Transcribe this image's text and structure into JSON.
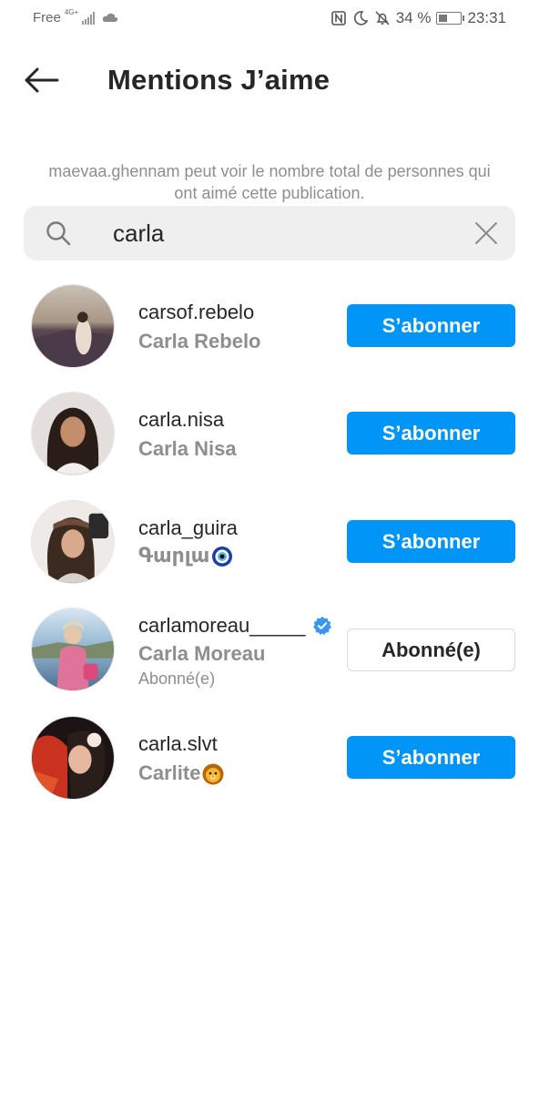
{
  "status_bar": {
    "carrier": "Free",
    "network": "4G+",
    "battery": "34 %",
    "time": "23:31"
  },
  "header": {
    "title": "Mentions J’aime",
    "back_icon": "arrow-left-icon"
  },
  "info_text": "maevaa.ghennam peut voir le nombre total de personnes qui ont aimé cette publication.",
  "search": {
    "value": "carla"
  },
  "users": [
    {
      "username": "carsof.rebelo",
      "fullname": "Carla Rebelo",
      "button": "S’abonner",
      "following": false
    },
    {
      "username": "carla.nisa",
      "fullname": "Carla Nisa",
      "button": "S’abonner",
      "following": false
    },
    {
      "username": "carla_guira",
      "fullname": "Գարլա",
      "button": "S’abonner",
      "following": false,
      "emoji": "nazar-amulet-icon"
    },
    {
      "username": "carlamoreau_____",
      "fullname": "Carla Moreau",
      "subtext": "Abonné(e)",
      "button": "Abonné(e)",
      "following": true,
      "verified": true
    },
    {
      "username": "carla.slvt",
      "fullname": "Carlite",
      "button": "S’abonner",
      "following": false,
      "emoji": "lion-face-icon"
    }
  ],
  "colors": {
    "accent": "#0095f6",
    "verified": "#3897f0",
    "secondary_text": "#8e8e8e",
    "search_bg": "#efefef"
  }
}
